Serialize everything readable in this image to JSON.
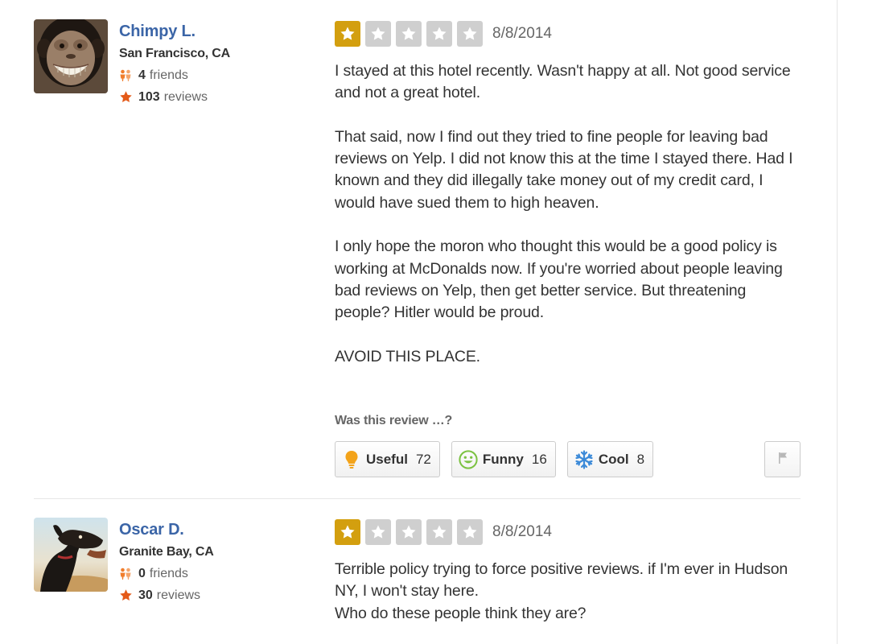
{
  "reviews": [
    {
      "user": {
        "name": "Chimpy L.",
        "location": "San Francisco, CA",
        "friends_count": "4",
        "friends_label": "friends",
        "reviews_count": "103",
        "reviews_label": "reviews",
        "avatar_icon": "chimpanzee-avatar"
      },
      "rating": 1,
      "max_rating": 5,
      "date": "8/8/2014",
      "paragraphs": [
        "I stayed at this hotel recently. Wasn't happy at all. Not good service and not a great hotel.",
        "That said, now I find out they tried to fine people for leaving bad reviews on Yelp. I did not know this at the time I stayed there. Had I known and they did illegally take money out of my credit card, I would have sued them to high heaven.",
        "I only hope the moron who thought this would be a good policy is working at McDonalds now. If you're worried about people leaving bad reviews on Yelp, then get better service. But threatening people? Hitler would be proud.",
        "AVOID THIS PLACE."
      ],
      "vote_prompt": "Was this review …?",
      "votes": {
        "useful": {
          "label": "Useful",
          "count": "72"
        },
        "funny": {
          "label": "Funny",
          "count": "16"
        },
        "cool": {
          "label": "Cool",
          "count": "8"
        }
      }
    },
    {
      "user": {
        "name": "Oscar D.",
        "location": "Granite Bay, CA",
        "friends_count": "0",
        "friends_label": "friends",
        "reviews_count": "30",
        "reviews_label": "reviews",
        "avatar_icon": "dog-avatar"
      },
      "rating": 1,
      "max_rating": 5,
      "date": "8/8/2014",
      "paragraphs": [
        "Terrible policy trying to force positive reviews. if I'm ever in Hudson NY, I won't stay here.\nWho do these people think they are?"
      ]
    }
  ],
  "colors": {
    "user_link": "#3b65a7",
    "star_on": "#d39f0f",
    "star_off": "#cfcfcf",
    "review_star_icon": "#e45a19",
    "friends_icon": "#f07d2c",
    "useful_icon": "#f3a31a",
    "funny_icon": "#7cc242",
    "cool_icon": "#3c8ad8"
  }
}
